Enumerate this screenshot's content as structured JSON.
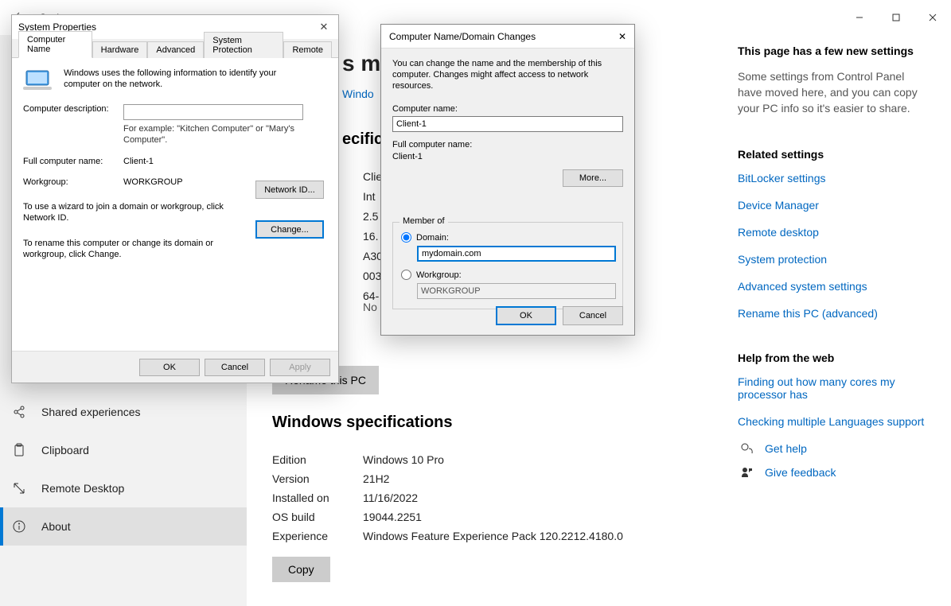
{
  "settings": {
    "title": "Settings",
    "window_controls": {
      "min": "—",
      "max": "▢",
      "close": "✕"
    },
    "sidebar": {
      "items": [
        {
          "label": "Shared experiences"
        },
        {
          "label": "Clipboard"
        },
        {
          "label": "Remote Desktop"
        },
        {
          "label": "About"
        }
      ]
    },
    "main": {
      "partial_heading_suffix": "s moni",
      "protection_link_partial": "Windo",
      "partial_h2_suffix": "ecifica",
      "spec_fragments": [
        "Clie",
        "Int",
        "2.5",
        "16.",
        "A30",
        "003",
        "64-"
      ],
      "nopen": "No pen or touch input is available for this display",
      "rename_button": "Rename this PC",
      "winspec_heading": "Windows specifications",
      "winspec": [
        {
          "k": "Edition",
          "v": "Windows 10 Pro"
        },
        {
          "k": "Version",
          "v": "21H2"
        },
        {
          "k": "Installed on",
          "v": "11/16/2022"
        },
        {
          "k": "OS build",
          "v": "19044.2251"
        },
        {
          "k": "Experience",
          "v": "Windows Feature Experience Pack 120.2212.4180.0"
        }
      ],
      "copy_button": "Copy"
    },
    "right": {
      "new_h": "This page has a few new settings",
      "new_t": "Some settings from Control Panel have moved here, and you can copy your PC info so it's easier to share.",
      "related_h": "Related settings",
      "related": [
        "BitLocker settings",
        "Device Manager",
        "Remote desktop",
        "System protection",
        "Advanced system settings",
        "Rename this PC (advanced)"
      ],
      "help_h": "Help from the web",
      "help_links": [
        "Finding out how many cores my processor has",
        "Checking multiple Languages support"
      ],
      "get_help": "Get help",
      "give_feedback": "Give feedback"
    }
  },
  "sysprop": {
    "title": "System Properties",
    "tabs": [
      "Computer Name",
      "Hardware",
      "Advanced",
      "System Protection",
      "Remote"
    ],
    "active_tab": 0,
    "info": "Windows uses the following information to identify your computer on the network.",
    "desc_label": "Computer description:",
    "desc_value": "",
    "example": "For example: \"Kitchen Computer\" or \"Mary's Computer\".",
    "full_name_label": "Full computer name:",
    "full_name_value": "Client-1",
    "workgroup_label": "Workgroup:",
    "workgroup_value": "WORKGROUP",
    "wizard_text": "To use a wizard to join a domain or workgroup, click Network ID.",
    "networkid_btn": "Network ID...",
    "change_text": "To rename this computer or change its domain or workgroup, click Change.",
    "change_btn": "Change...",
    "footer": {
      "ok": "OK",
      "cancel": "Cancel",
      "apply": "Apply"
    }
  },
  "domdlg": {
    "title": "Computer Name/Domain Changes",
    "desc": "You can change the name and the membership of this computer. Changes might affect access to network resources.",
    "cname_label": "Computer name:",
    "cname_value": "Client-1",
    "fullname_label": "Full computer name:",
    "fullname_value": "Client-1",
    "more_btn": "More...",
    "memberof": "Member of",
    "domain_radio": "Domain:",
    "domain_value": "mydomain.com",
    "workgroup_radio": "Workgroup:",
    "workgroup_value": "WORKGROUP",
    "ok": "OK",
    "cancel": "Cancel"
  }
}
